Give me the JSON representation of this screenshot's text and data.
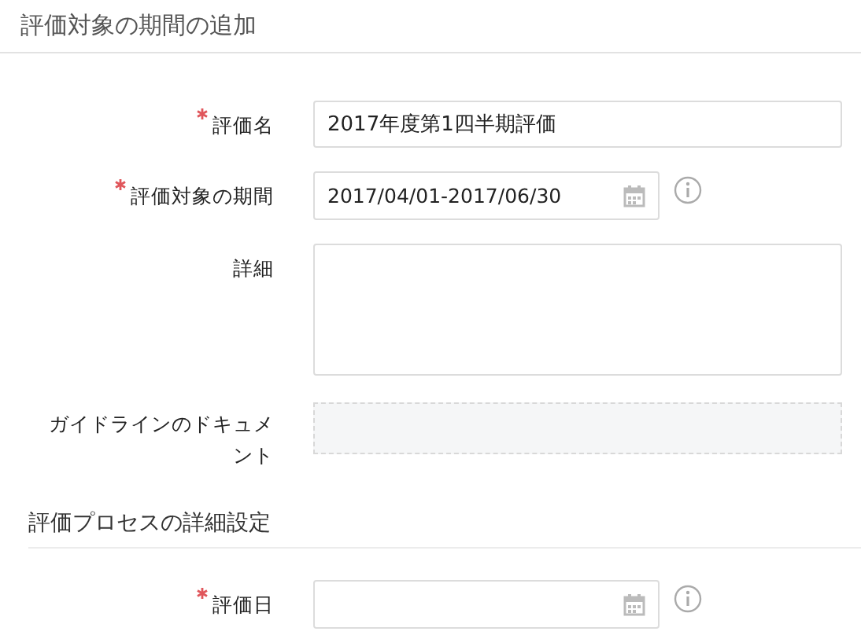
{
  "title": "評価対象の期間の追加",
  "fields": [
    {
      "kind": "text",
      "label": "評価名",
      "required": true,
      "value": "2017年度第1四半期評価"
    },
    {
      "kind": "date",
      "label": "評価対象の期間",
      "required": true,
      "value": "2017/04/01-2017/06/30",
      "info": true
    },
    {
      "kind": "textarea",
      "label": "詳細",
      "required": false
    },
    {
      "kind": "upload",
      "label": "ガイドラインのドキュメント",
      "required": false
    }
  ],
  "section": {
    "title": "評価プロセスの詳細設定",
    "fields": [
      {
        "kind": "date",
        "label": "評価日",
        "required": true,
        "info": true
      }
    ]
  }
}
